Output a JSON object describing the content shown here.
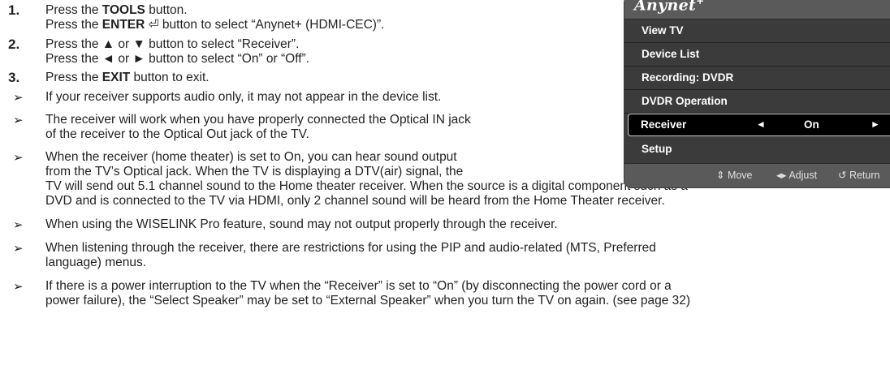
{
  "steps": [
    {
      "number": "1.",
      "lines": [
        {
          "pre": "Press the ",
          "bold": "TOOLS",
          "post": " button."
        },
        {
          "pre": "Press the ",
          "bold": "ENTER",
          "post": " ⏎ button to select “Anynet+ (HDMI-CEC)”."
        }
      ]
    },
    {
      "number": "2.",
      "lines": [
        {
          "pre": "Press the ▲ or ▼ button to select “Receiver”.",
          "bold": "",
          "post": ""
        },
        {
          "pre": "Press the ◄ or ► button to select “On” or “Off”.",
          "bold": "",
          "post": ""
        }
      ]
    },
    {
      "number": "3.",
      "lines": [
        {
          "pre": "Press the ",
          "bold": "EXIT",
          "post": " button to exit."
        }
      ]
    }
  ],
  "notes": [
    {
      "lines": [
        "If your receiver supports audio only, it may not appear in the device list."
      ]
    },
    {
      "lines": [
        "The receiver will work when you have properly connected the Optical IN jack",
        "of the receiver to the Optical Out jack of the TV."
      ]
    },
    {
      "lines": [
        "When the receiver (home theater) is set to On, you can hear sound output",
        "from the TV’s Optical jack. When the TV is displaying a DTV(air) signal, the",
        "TV will send out 5.1 channel sound to the Home theater receiver. When the source is a digital component such as a",
        "DVD and is connected to the TV via HDMI, only 2 channel sound will be heard from the Home Theater receiver."
      ]
    },
    {
      "lines": [
        "When using the WISELINK Pro feature, sound may not output properly through the receiver."
      ]
    },
    {
      "lines": [
        "When listening through the receiver, there are restrictions for using the PIP and audio-related (MTS, Preferred",
        "language) menus."
      ]
    },
    {
      "lines": [
        "If there is a power interruption to the TV when the “Receiver” is set to “On” (by disconnecting the power cord or a",
        "power failure), the “Select Speaker” may be set to “External Speaker” when you turn the TV on again. (see page 32)"
      ]
    }
  ],
  "note_marker": "➢",
  "osd": {
    "logo": "Anynet",
    "logo_plus": "+",
    "items": [
      "View TV",
      "Device List",
      "Recording: DVDR",
      "DVDR Operation",
      "Receiver",
      "Setup"
    ],
    "selected_index": 4,
    "selected_value": "On",
    "left_arrow": "◄",
    "right_arrow": "►",
    "footer": {
      "move": "⇕ Move",
      "adjust": "◂▸ Adjust",
      "return": "↺ Return"
    }
  }
}
